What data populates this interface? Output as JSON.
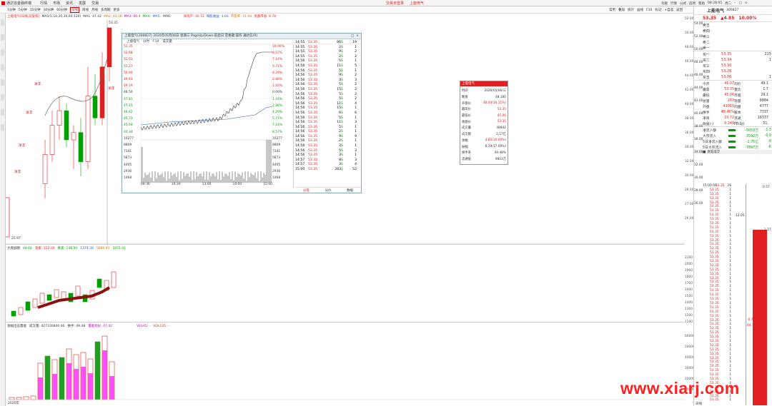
{
  "toolbar": {
    "app": "通达信金融终端",
    "menus": [
      "行情",
      "市场",
      "资讯",
      "发展",
      "交易"
    ],
    "center1": "交易未登录",
    "center2": "上能电气",
    "right": [
      "功能",
      "行情",
      "公式",
      "选项",
      "帮助"
    ],
    "time": "08:28:05",
    "day": "周二"
  },
  "periods": [
    "1分钟",
    "5分钟",
    "15分钟",
    "30分钟",
    "60分钟",
    "日线",
    "周线",
    "月线",
    "多周期",
    "更多"
  ],
  "right_tabs": [
    "常用",
    "叠加",
    "统计",
    "画线",
    "F10",
    "标记",
    "+自选",
    "返回"
  ],
  "main_chart": {
    "title": "上能电气(日线,前复权)",
    "ma_label": "MA5(5,10,20,30,60,120)",
    "ma1": "MA1: 47.42",
    "ma2": "MA2: 45.16",
    "ma3": "MA3: 40.4",
    "ma4": "MA4:",
    "ma5": "MA5:",
    "ma6": "MA6:",
    "indicators": [
      "净资产: 10.72",
      "每股收益: 1.03",
      "市盈率: 51.94",
      "流通市值: 9.78"
    ],
    "high_label": "53.35",
    "low_label": "25.97",
    "signal": "净浮",
    "y_ticks": [
      "52.00",
      "50.00",
      "48.00",
      "46.00",
      "44.00",
      "42.00",
      "40.00",
      "38.00",
      "36.00",
      "34.00",
      "32.00",
      "30.00",
      "28.00",
      "27.00",
      "26.00"
    ]
  },
  "panel2": {
    "title": "大盘副图",
    "v1": "48.64",
    "v2": "涨家: 122.00",
    "v3": "跌家: 138.00",
    "v4": "1374.58",
    "v5": "5880.81",
    "v6": "2051.01",
    "y_ticks": [
      "2100",
      "2000",
      "1900",
      "1800",
      "1700",
      "1600",
      "1500",
      "1400",
      "1300",
      "1200",
      "1100"
    ]
  },
  "panel3": {
    "title": "涨幅出击量能",
    "vol": "成交量: 427330840.00",
    "chg": "换手: 49.48",
    "ratio": "量能指标: 47.42",
    "vol45": "VOL45: -",
    "vol135": "VOL135: -",
    "y_ticks": [
      "60000",
      "50000",
      "40000",
      "30000",
      "20000",
      "10000"
    ],
    "xlabel": "2020年"
  },
  "popup": {
    "title": "上能电气(300827) 2020年05月06日 星期三 PageUp/Down:前后日 空格键:操作 通达信(R)",
    "subtitle": "上能电气",
    "tabs": [
      "分时",
      "F10",
      "成交量"
    ],
    "left_ticks": [
      "53.35",
      "52.68",
      "52.01",
      "51.27",
      "50.60",
      "49.93",
      "49.19",
      "48.50",
      "47.81",
      "47.15",
      "46.42",
      "45.73",
      "45.04",
      "44.34",
      "10277",
      "8809",
      "7341",
      "5873",
      "4405",
      "2936",
      "1468"
    ],
    "right_ticks": [
      "10.00%",
      "8.57%",
      "7.14%",
      "5.71%",
      "4.29%",
      "2.86%",
      "1.43%",
      "0.00%",
      "1.43%",
      "2.86%",
      "4.29%",
      "5.71%",
      "7.14%",
      "8.57%",
      "10277",
      "8809",
      "7341",
      "5873",
      "4405",
      "2936",
      "1468"
    ],
    "times": [
      "09:30",
      "10:30",
      "13:00",
      "14:00",
      "15:00"
    ],
    "foot": [
      "分笔",
      "分价",
      "数据"
    ]
  },
  "ticks": [
    [
      "14:55",
      "53.35",
      "86",
      "S",
      "19"
    ],
    [
      "14:55",
      "53.35",
      "2",
      "S",
      "1"
    ],
    [
      "14:55",
      "53.35",
      "9",
      "S",
      "2"
    ],
    [
      "14:55",
      "53.35",
      "2",
      "S",
      "2"
    ],
    [
      "14:56",
      "53.35",
      "5",
      "S",
      "1"
    ],
    [
      "14:56",
      "53.35",
      "11",
      "S",
      "5"
    ],
    [
      "14:56",
      "53.35",
      "5",
      "S",
      "1"
    ],
    [
      "14:56",
      "53.35",
      "9",
      "S",
      "2"
    ],
    [
      "14:56",
      "53.35",
      "3",
      "S",
      "3"
    ],
    [
      "14:56",
      "53.35",
      "5",
      "S",
      "2"
    ],
    [
      "14:56",
      "53.35",
      "15",
      "S",
      "2"
    ],
    [
      "14:56",
      "53.35",
      "5",
      "S",
      "2"
    ],
    [
      "14:56",
      "53.35",
      "5",
      "S",
      "2"
    ],
    [
      "14:56",
      "53.35",
      "11",
      "S",
      "4"
    ],
    [
      "14:56",
      "53.35",
      "15",
      "S",
      "1"
    ],
    [
      "14:56",
      "53.35",
      "6",
      "S",
      "6"
    ],
    [
      "14:56",
      "53.35",
      "5",
      "S",
      "1"
    ],
    [
      "14:56",
      "53.35",
      "11",
      "S",
      "3"
    ],
    [
      "14:56",
      "53.35",
      "5",
      "S",
      "1"
    ],
    [
      "14:56",
      "53.35",
      "2",
      "S",
      "1"
    ],
    [
      "14:56",
      "53.35",
      "9",
      "S",
      "9"
    ],
    [
      "14:56",
      "53.35",
      "2",
      "S",
      "1"
    ],
    [
      "14:56",
      "53.35",
      "3",
      "S",
      "1"
    ],
    [
      "14:56",
      "53.35",
      "5",
      "S",
      "3"
    ],
    [
      "14:56",
      "53.35",
      "3",
      "S",
      "1"
    ],
    [
      "14:57",
      "53.35",
      "8",
      "S",
      "3"
    ],
    [
      "14:57",
      "53.35",
      "3",
      "S",
      "4"
    ],
    [
      "15:00",
      "53.35",
      "283",
      "S",
      "52"
    ]
  ],
  "tooltip": {
    "title": "上能电气",
    "rows": [
      [
        "时间",
        "2020/05/06/三"
      ],
      [
        "数值",
        "48.180"
      ],
      [
        "开盘价",
        "48.00(16.11%)"
      ],
      [
        "最高价",
        "53.35"
      ],
      [
        "最低价",
        "45.06"
      ],
      [
        "收盘价",
        "53.35"
      ],
      [
        "成交量",
        "48842"
      ],
      [
        "成交额",
        "2.57亿"
      ],
      [
        "涨幅",
        "4.85(10.00%)"
      ],
      [
        "振幅",
        "8.29(17.09%)"
      ],
      [
        "换手率",
        "49.48%"
      ],
      [
        "流通股",
        "9803万"
      ]
    ]
  },
  "quote": {
    "name": "上能电气",
    "code": "300827",
    "price": "53.35",
    "change": "▲4.85",
    "pct": "10.00%",
    "asks": [
      [
        "卖五",
        "",
        ""
      ],
      [
        "卖四",
        "",
        ""
      ],
      [
        "卖三",
        "",
        ""
      ],
      [
        "卖二",
        "",
        ""
      ],
      [
        "卖一",
        "",
        ""
      ]
    ],
    "bids": [
      [
        "买一",
        "53.35",
        "215"
      ],
      [
        "买二",
        "53.34",
        "1"
      ],
      [
        "买三",
        "53.30",
        ""
      ],
      [
        "买四",
        "53.28",
        ""
      ],
      [
        "买五",
        "53.06",
        "1"
      ]
    ],
    "stats": [
      [
        "今开",
        "46.07",
        "均价",
        "49.1"
      ],
      [
        "最高",
        "53.35",
        "量比",
        "1.7"
      ],
      [
        "最低",
        "45.06",
        "市值",
        "29.1"
      ],
      [
        "总量",
        "283",
        "现量",
        "8884"
      ],
      [
        "外盘",
        "41065",
        "内盘",
        "4777"
      ],
      [
        "换手",
        "48.46%",
        "股本",
        "7337"
      ],
      [
        "净资",
        "10.72",
        "流通",
        "18337"
      ],
      [
        "收益(-)",
        "0.349",
        "PE(动)",
        "51."
      ]
    ],
    "flows": [
      [
        "净流入额",
        "-5053万",
        "-1.3"
      ],
      [
        "大宗流入",
        "-3592万",
        "-0.9"
      ],
      [
        "5日净流入额",
        "-1.75亿",
        "-9"
      ],
      [
        "5日大宗流入",
        "-7897万",
        "-6"
      ]
    ],
    "section": "逐笔成交",
    "right_ticks": [
      "54.00",
      "52.00",
      "50.00",
      "48.00",
      "46.00",
      "44.00",
      "42.00",
      "40.00",
      "38.00",
      "36.00",
      "34.00",
      "32.00",
      "30.00",
      "28.00",
      "26.00"
    ],
    "depth_label1": "0.57",
    "depth_label2": "12.05",
    "depth_label3": "1.27",
    "depth_label4": "-0.77",
    "depth_label5": "64.73",
    "bottom": "日线"
  },
  "stream": {
    "time": "15:00:00",
    "price": "53.35",
    "count": "28",
    "vol": "1"
  },
  "watermark": "www.xiarj.com",
  "chart_data": [
    {
      "type": "candlestick",
      "name": "main",
      "candles": [
        [
          32,
          38,
          30,
          36
        ],
        [
          36,
          42,
          35,
          40
        ],
        [
          40,
          44,
          38,
          42
        ],
        [
          42,
          43,
          37,
          38
        ],
        [
          38,
          40,
          34,
          39
        ],
        [
          39,
          41,
          33,
          35
        ],
        [
          35,
          48,
          34,
          44
        ],
        [
          44,
          47,
          40,
          41
        ],
        [
          41,
          50,
          40,
          48
        ],
        [
          48,
          53,
          46,
          53.35
        ]
      ],
      "ylim": [
        25,
        53.35
      ]
    },
    {
      "type": "line",
      "name": "intraday",
      "x": [
        "09:30",
        "10:30",
        "13:00",
        "14:00",
        "15:00"
      ],
      "values": [
        48.0,
        47.0,
        47.6,
        48.6,
        53.35
      ]
    }
  ]
}
